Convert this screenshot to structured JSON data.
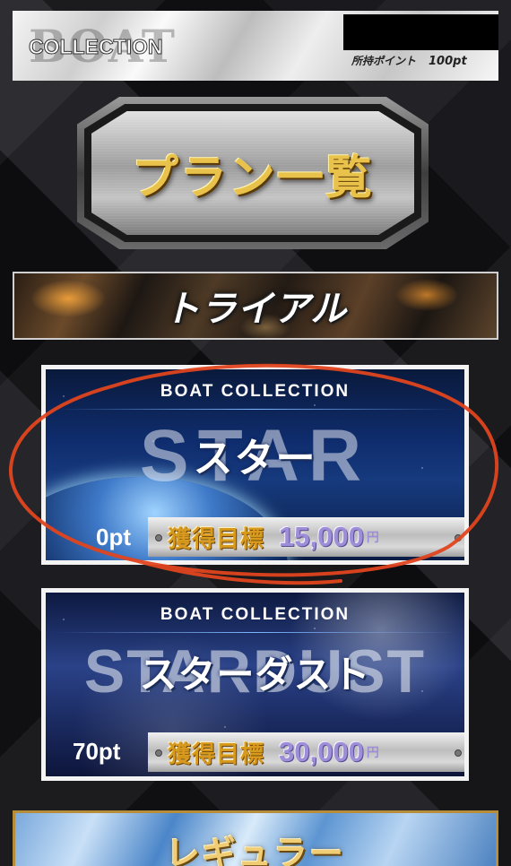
{
  "header": {
    "logo_main": "BOAT",
    "logo_sub": "COLLECTION",
    "points_label": "所持ポイント",
    "points_value": "100pt"
  },
  "plan_list_title": "プラン一覧",
  "trial_section": {
    "label": "トライアル"
  },
  "plans": [
    {
      "brand": "BOAT COLLECTION",
      "name_en": "STAR",
      "name_jp": "スター",
      "points": "0pt",
      "target_label": "獲得目標",
      "target_amount": "15,000",
      "target_unit": "円"
    },
    {
      "brand": "BOAT COLLECTION",
      "name_en": "STARDUST",
      "name_jp": "スターダスト",
      "points": "70pt",
      "target_label": "獲得目標",
      "target_amount": "30,000",
      "target_unit": "円"
    }
  ],
  "regular_section": {
    "label": "レギュラー"
  },
  "colors": {
    "accent_gold": "#e8c24a",
    "target_purple": "#9e8ed8",
    "annotation_red": "#e0441e"
  }
}
